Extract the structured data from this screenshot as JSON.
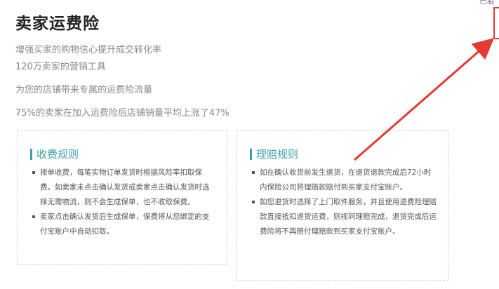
{
  "header": {
    "title": "卖家运费险",
    "corner_text": "已看"
  },
  "taglines": [
    "增强买家的购物信心提升成交转化率",
    "120万卖家的营销工具",
    "为您的店铺带来专属的运费险流量",
    "75%的卖家在加入运费险后店铺销量平均上涨了47%"
  ],
  "cards": {
    "fee_rules": {
      "heading": "收费规则",
      "items": [
        "按单收费，每笔实物订单发货时根据风险率扣取保费。如卖家未点击确认发货或卖家点击确认发货时选择无需物流，则不会生成保单，也不收取保费。",
        "卖家点击确认发货后生成保单，保费将从您绑定的支付宝账户中自动扣取。"
      ]
    },
    "claim_rules": {
      "heading": "理赔规则",
      "items": [
        "如在确认收货前发生退货，在退货退款完成后72小时内保险公司将理赔款赔付到买家支付宝账户。",
        "如您退货时选择了上门取件服务，并且使用退费险理赔款直接抵扣退货运费，则视同理赔完成，退货完成后运费险将不再赔付理赔款到买家支付宝账户。"
      ]
    }
  },
  "colors": {
    "accent": "#3a9fa6",
    "annotation": "#e53935"
  }
}
